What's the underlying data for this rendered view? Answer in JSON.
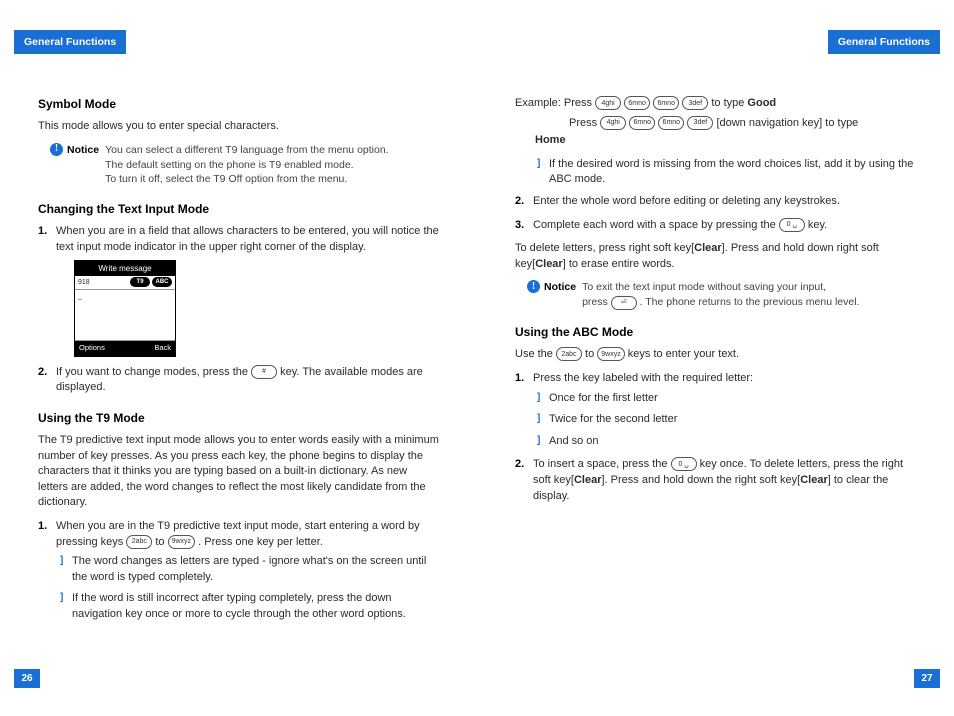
{
  "header": {
    "left": "General Functions",
    "right": "General Functions"
  },
  "pagenum": {
    "left": "26",
    "right": "27"
  },
  "left": {
    "sec1": {
      "title": "Symbol Mode",
      "p": "This mode allows you to enter special characters."
    },
    "notice1": {
      "label": "Notice",
      "l1": "You can select a different T9 language from the menu option.",
      "l2": "The default setting on the phone is T9 enabled mode.",
      "l3": "To turn it off, select the T9 Off option from the menu."
    },
    "sec2": {
      "title": "Changing the Text Input Mode",
      "step1": "When you are in a field that allows characters to be entered, you will notice the text input mode indicator in the upper right corner of the display.",
      "phone": {
        "title": "Write message",
        "top_left": "918",
        "ind1": "T9",
        "ind2": "ABC",
        "cursor": "_",
        "opt": "Options",
        "back": "Back"
      },
      "step2a": "If you want to change modes, press the ",
      "step2_key": "#",
      "step2b": " key. The available modes are displayed."
    },
    "sec3": {
      "title": "Using the T9 Mode",
      "p": "The T9 predictive text input mode allows you to enter words easily with a minimum number of key presses. As you press each key, the phone begins to display the characters that it thinks you are typing based on a built-in dictionary. As new letters are added, the word changes to reflect the most likely candidate from the dictionary.",
      "step1a": "When you are in the T9 predictive text input mode, start entering a word by pressing keys ",
      "step1_k1": "2abc",
      "step1_mid": " to ",
      "step1_k2": "9wxyz",
      "step1b": " . Press one key per letter.",
      "sub1": "The word changes as letters are typed - ignore what's on the screen until the word is typed completely.",
      "sub2": "If the word is still incorrect after typing completely, press the down navigation key once or more to cycle through the other word options."
    }
  },
  "right": {
    "example": {
      "pre": "Example: Press ",
      "k": [
        "4ghi",
        "6mno",
        "6mno",
        "3def"
      ],
      "mid1": " to type ",
      "w1": "Good",
      "press2": "Press ",
      "k2": [
        "4ghi",
        "6mno",
        "6mno",
        "3def"
      ],
      "mid2": " [down navigation key] to type ",
      "w2": "Home"
    },
    "sub1": "If the desired word is missing from the word choices list, add it by using the ABC mode.",
    "step2": "Enter the whole word before editing or deleting any keystrokes.",
    "step3a": "Complete each word with a space by pressing the ",
    "step3_key": "0 ␣",
    "step3b": " key.",
    "del_a": "To delete letters, press right soft key[",
    "del_c": "Clear",
    "del_b": "]. Press and hold down right soft key[",
    "del_d": "] to erase entire words.",
    "notice2": {
      "label": "Notice",
      "l1": "To exit the text input mode without saving your input,",
      "l2a": "press ",
      "key": "⏎",
      "l2b": " . The phone returns to the previous menu level."
    },
    "abc": {
      "title": "Using the ABC Mode",
      "p_a": "Use the ",
      "k1": "2abc",
      "p_mid": " to ",
      "k2": "9wxyz",
      "p_b": " keys to enter your text.",
      "s1": "Press the key labeled with the required letter:",
      "sub1": "Once for the first letter",
      "sub2": "Twice for the second letter",
      "sub3": "And so on",
      "s2a": "To insert a space, press the ",
      "s2_key": "0 ␣",
      "s2b": " key once. To delete letters, press the right soft key[",
      "s2_clear": "Clear",
      "s2c": "]. Press and hold down the right soft key[",
      "s2d": "] to clear the display."
    }
  }
}
